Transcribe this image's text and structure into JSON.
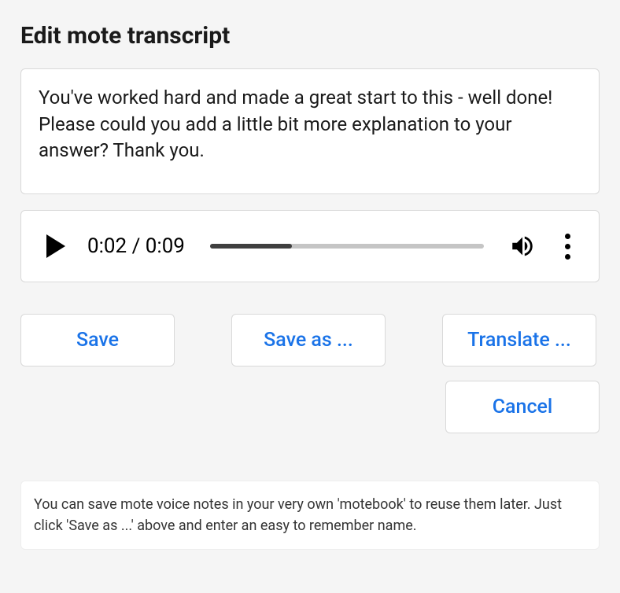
{
  "heading": "Edit mote transcript",
  "transcript": "You've worked hard and made a great start to this - well done! Please could you add a little bit more explanation to your answer? Thank you.",
  "audio": {
    "current_time": "0:02",
    "duration": "0:09",
    "progress_percent": 30
  },
  "buttons": {
    "save": "Save",
    "save_as": "Save as ...",
    "translate": "Translate ...",
    "cancel": "Cancel"
  },
  "tip": "You can save mote voice notes in your very own 'motebook' to reuse them later. Just click 'Save as ...' above and enter an easy to remember name."
}
